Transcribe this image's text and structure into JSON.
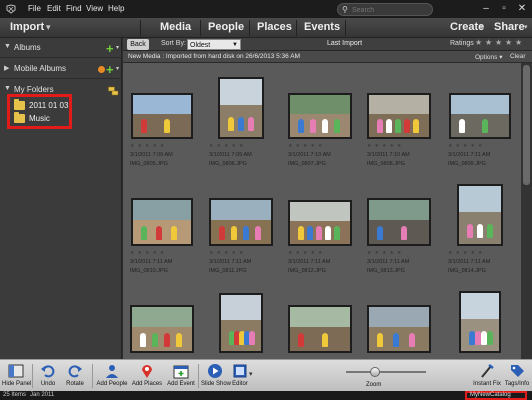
{
  "menu": {
    "file": "File",
    "edit": "Edit",
    "find": "Find",
    "view": "View",
    "help": "Help"
  },
  "search": {
    "placeholder": "Search"
  },
  "topbar": {
    "import": "Import",
    "tabs": [
      "Media",
      "People",
      "Places",
      "Events"
    ],
    "create": "Create",
    "share": "Share"
  },
  "left_panel": {
    "albums": "Albums",
    "mobile_albums": "Mobile Albums",
    "my_folders": "My Folders",
    "folders": [
      "2011 01 03",
      "Music"
    ]
  },
  "browser": {
    "back": "Back",
    "sort_by_label": "Sort By:",
    "sort_by_value": "Oldest",
    "view_title": "Last Import",
    "ratings_label": "Ratings",
    "info": "New Media : Imported from hard disk on 26/6/2013 5:36 AM",
    "options": "Options",
    "clear": "Clear"
  },
  "thumbnails": [
    {
      "date": "3/1/2011 7:09 AM",
      "file": "IMG_0805.JPG"
    },
    {
      "date": "3/1/2011 7:09 AM",
      "file": "IMG_0806.JPG"
    },
    {
      "date": "3/1/2011 7:10 AM",
      "file": "IMG_0807.JPG"
    },
    {
      "date": "3/1/2011 7:10 AM",
      "file": "IMG_0808.JPG"
    },
    {
      "date": "3/1/2011 7:11 AM",
      "file": "IMG_0809.JPG"
    },
    {
      "date": "3/1/2011 7:11 AM",
      "file": "IMG_0810.JPG"
    },
    {
      "date": "3/1/2011 7:11 AM",
      "file": "IMG_0811.JPG"
    },
    {
      "date": "3/1/2011 7:11 AM",
      "file": "IMG_0812.JPG"
    },
    {
      "date": "3/1/2011 7:11 AM",
      "file": "IMG_0813.JPG"
    },
    {
      "date": "3/1/2011 7:11 AM",
      "file": "IMG_0814.JPG"
    },
    {
      "date": "",
      "file": ""
    },
    {
      "date": "",
      "file": ""
    },
    {
      "date": "",
      "file": ""
    },
    {
      "date": "",
      "file": ""
    },
    {
      "date": "",
      "file": ""
    }
  ],
  "bottom_tools": {
    "hide_panel": "Hide Panel",
    "undo": "Undo",
    "rotate": "Rotate",
    "add_people": "Add People",
    "add_places": "Add Places",
    "add_event": "Add Event",
    "slide_show": "Slide Show",
    "editor": "Editor",
    "zoom": "Zoom",
    "instant_fix": "Instant Fix",
    "tags_info": "Tags/Info"
  },
  "status": {
    "items": "25 Items",
    "date": "Jan 2011",
    "catalog": "MyNewCatalog"
  },
  "colors": {
    "highlight_red": "#e11a1a",
    "plus_green": "#6fcf3a",
    "folder_yellow": "#e7c24a"
  }
}
